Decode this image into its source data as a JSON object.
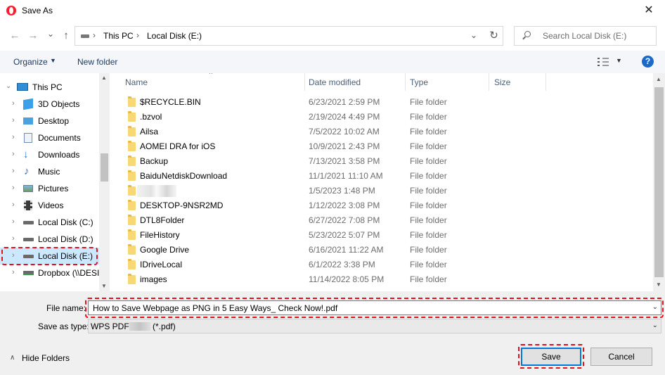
{
  "window": {
    "title": "Save As",
    "close_glyph": "✕"
  },
  "nav": {
    "back_glyph": "←",
    "forward_glyph": "→",
    "recent_glyph": "⌄",
    "up_glyph": "↑",
    "breadcrumbs": [
      "This PC",
      "Local Disk (E:)"
    ],
    "breadcrumb_sep": "›",
    "refresh_glyph": "↻",
    "search_placeholder": "Search Local Disk (E:)"
  },
  "toolbar": {
    "organize": "Organize",
    "caret": "▼",
    "new_folder": "New folder",
    "help": "?"
  },
  "tree": [
    {
      "label": "This PC",
      "icon": "pc-icon",
      "level": 0,
      "expanded": true
    },
    {
      "label": "3D Objects",
      "icon": "3d-objects-icon",
      "level": 1
    },
    {
      "label": "Desktop",
      "icon": "desktop-icon",
      "level": 1
    },
    {
      "label": "Documents",
      "icon": "documents-icon",
      "level": 1
    },
    {
      "label": "Downloads",
      "icon": "downloads-icon",
      "level": 1
    },
    {
      "label": "Music",
      "icon": "music-icon",
      "level": 1
    },
    {
      "label": "Pictures",
      "icon": "pictures-icon",
      "level": 1
    },
    {
      "label": "Videos",
      "icon": "videos-icon",
      "level": 1
    },
    {
      "label": "Local Disk (C:)",
      "icon": "drive-icon",
      "level": 1
    },
    {
      "label": "Local Disk (D:)",
      "icon": "drive-icon",
      "level": 1
    },
    {
      "label": "Local Disk (E:)",
      "icon": "drive-icon",
      "level": 1,
      "selected": true
    },
    {
      "label": "Dropbox (\\\\DESI",
      "icon": "network-drive-icon",
      "level": 1
    }
  ],
  "columns": {
    "name": "Name",
    "date": "Date modified",
    "type": "Type",
    "size": "Size"
  },
  "files": [
    {
      "name": "$RECYCLE.BIN",
      "date": "6/23/2021 2:59 PM",
      "type": "File folder"
    },
    {
      "name": ".bzvol",
      "date": "2/19/2024 4:49 PM",
      "type": "File folder"
    },
    {
      "name": "Ailsa",
      "date": "7/5/2022 10:02 AM",
      "type": "File folder"
    },
    {
      "name": "AOMEI DRA for iOS",
      "date": "10/9/2021 2:43 PM",
      "type": "File folder"
    },
    {
      "name": "Backup",
      "date": "7/13/2021 3:58 PM",
      "type": "File folder"
    },
    {
      "name": "BaiduNetdiskDownload",
      "date": "11/1/2021 11:10 AM",
      "type": "File folder"
    },
    {
      "name": "",
      "date": "1/5/2023 1:48 PM",
      "type": "File folder",
      "blurred": true
    },
    {
      "name": "DESKTOP-9NSR2MD",
      "date": "1/12/2022 3:08 PM",
      "type": "File folder"
    },
    {
      "name": "DTL8Folder",
      "date": "6/27/2022 7:08 PM",
      "type": "File folder"
    },
    {
      "name": "FileHistory",
      "date": "5/23/2022 5:07 PM",
      "type": "File folder"
    },
    {
      "name": "Google Drive",
      "date": "6/16/2021 11:22 AM",
      "type": "File folder"
    },
    {
      "name": "IDriveLocal",
      "date": "6/1/2022 3:38 PM",
      "type": "File folder"
    },
    {
      "name": "images",
      "date": "11/14/2022 8:05 PM",
      "type": "File folder"
    }
  ],
  "form": {
    "file_name_label": "File name:",
    "file_name_value": "How to Save Webpage as PNG in 5 Easy Ways_ Check Now!.pdf",
    "save_as_type_label": "Save as type:",
    "save_as_type_prefix": "WPS PDF",
    "save_as_type_suffix": "(*.pdf)",
    "dropdown_caret": "⌄"
  },
  "footer": {
    "hide_folders": "Hide Folders",
    "hide_caret": "∧",
    "save": "Save",
    "cancel": "Cancel"
  }
}
